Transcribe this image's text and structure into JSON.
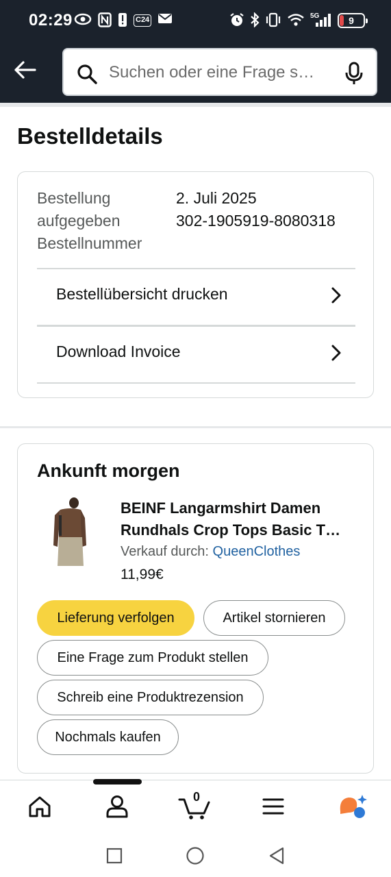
{
  "status_bar": {
    "time": "02:29",
    "left_icons": [
      "eye-icon",
      "nfc-icon",
      "alert-icon",
      "c24-icon",
      "mail-icon"
    ],
    "c24_label": "C24",
    "network_label": "5G",
    "battery_level": "9",
    "right_icons": [
      "alarm-icon",
      "bluetooth-icon",
      "vibrate-icon",
      "wifi-icon",
      "signal-icon",
      "battery-icon"
    ]
  },
  "header": {
    "search_placeholder": "Suchen oder eine Frage s…"
  },
  "page": {
    "title": "Bestelldetails"
  },
  "order_card": {
    "labels": [
      "Bestellung",
      "aufgegeben",
      "Bestellnummer"
    ],
    "order_date": "2. Juli 2025",
    "order_number": "302-1905919-8080318",
    "links": [
      {
        "label": "Bestellübersicht drucken"
      },
      {
        "label": "Download Invoice"
      }
    ]
  },
  "shipment_card": {
    "heading": "Ankunft morgen",
    "product": {
      "title": "BEINF Langarmshirt Damen Rundhals Crop Tops Basic T…",
      "seller_prefix": "Verkauf durch:",
      "seller_name": "QueenClothes",
      "price": "11,99€"
    },
    "actions": {
      "track": "Lieferung verfolgen",
      "cancel": "Artikel stornieren",
      "question": "Eine Frage zum Produkt stellen",
      "review": "Schreib eine Produktrezension",
      "rebuy": "Nochmals kaufen"
    }
  },
  "tab_bar": {
    "cart_count": "0",
    "tabs": [
      "home-icon",
      "account-icon",
      "cart-icon",
      "menu-icon",
      "rufus-icon"
    ]
  },
  "colors": {
    "header_bg": "#1b222c",
    "primary_button": "#f7d340",
    "link": "#2162a1",
    "border": "#d5d9d9"
  }
}
